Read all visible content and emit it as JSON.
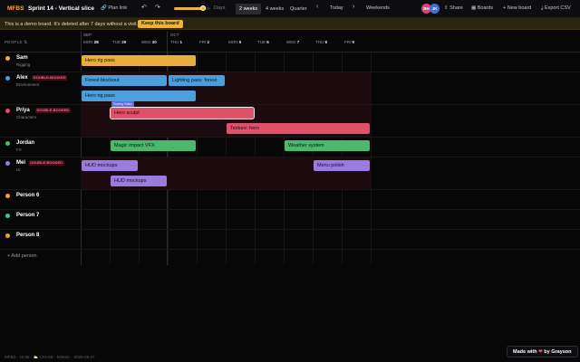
{
  "app": {
    "logo": "MFBS",
    "title": "Sprint 14 - Vertical slice"
  },
  "toolbar": {
    "plan_link": "Plan link",
    "undo_icon": "↶",
    "redo_icon": "↷",
    "zoom_label": "Days",
    "zoom_fraction": 0.8,
    "views": [
      "2 weeks",
      "4 weeks",
      "Quarter"
    ],
    "active_view": "2 weeks",
    "prev_icon": "‹",
    "today": "Today",
    "next_icon": "›",
    "weekends": "Weekends",
    "share": "Share",
    "boards": "Boards",
    "new_board": "+ New board",
    "export": "Export CSV",
    "avatars": [
      {
        "initials": "BH",
        "color": "#d0467a"
      },
      {
        "initials": "JK",
        "color": "#3d6fd6"
      }
    ]
  },
  "banner": {
    "message": "This is a demo board. It's deleted after 7 days without a visit.",
    "keep": "Keep this board"
  },
  "timeline": {
    "people_header": "PEOPLE ⇅",
    "months": [
      {
        "label": "SEP",
        "col": 0
      },
      {
        "label": "OCT",
        "col": 3
      }
    ],
    "days": [
      {
        "dow": "MON",
        "num": "28"
      },
      {
        "dow": "TUE",
        "num": "29"
      },
      {
        "dow": "WED",
        "num": "30"
      },
      {
        "dow": "THU",
        "num": "1"
      },
      {
        "dow": "FRI",
        "num": "2"
      },
      {
        "dow": "MON",
        "num": "5"
      },
      {
        "dow": "TUE",
        "num": "6"
      },
      {
        "dow": "WED",
        "num": "7"
      },
      {
        "dow": "THU",
        "num": "8"
      },
      {
        "dow": "FRI",
        "num": "9"
      }
    ],
    "today_col": 0
  },
  "people": [
    {
      "name": "Sam",
      "role": "Rigging",
      "color": "#f2b233",
      "double_booked": false
    },
    {
      "name": "Alex",
      "role": "Environment",
      "color": "#4b9fdc",
      "double_booked": true
    },
    {
      "name": "Priya",
      "role": "Characters",
      "color": "#e0506a",
      "double_booked": true
    },
    {
      "name": "Jordan",
      "role": "FX",
      "color": "#4bb86f",
      "double_booked": false
    },
    {
      "name": "Mei",
      "role": "UI",
      "color": "#9a7be0",
      "double_booked": true
    },
    {
      "name": "Person 6",
      "role": "",
      "color": "#f2a03a",
      "double_booked": false
    },
    {
      "name": "Person 7",
      "role": "",
      "color": "#3fc2a8",
      "double_booked": false
    },
    {
      "name": "Person 8",
      "role": "",
      "color": "#e0a63a",
      "double_booked": false
    }
  ],
  "double_booked_label": "DOUBLE-BOOKED",
  "tasks": [
    {
      "label": "Hero rig pass",
      "person": 0,
      "lane": 0,
      "start": 0,
      "span": 4,
      "color": "#e7ad3f"
    },
    {
      "label": "Forest blockout",
      "person": 1,
      "lane": 0,
      "start": 0,
      "span": 3,
      "color": "#4b9fdc"
    },
    {
      "label": "Lighting pass: forest",
      "person": 1,
      "lane": 0,
      "start": 3,
      "span": 2,
      "color": "#4b9fdc"
    },
    {
      "label": "Hero rig pass",
      "person": 1,
      "lane": 1,
      "start": 0,
      "span": 4,
      "color": "#4b9fdc"
    },
    {
      "label": "Hero sculpt",
      "person": 2,
      "lane": 0,
      "start": 1,
      "span": 5,
      "color": "#e0506a",
      "selected": true,
      "tag": "Sunny Kato"
    },
    {
      "label": "Texture: hero",
      "person": 2,
      "lane": 1,
      "start": 5,
      "span": 5,
      "color": "#e0506a"
    },
    {
      "label": "Magic impact VFX",
      "person": 3,
      "lane": 0,
      "start": 1,
      "span": 3,
      "color": "#4bb86f"
    },
    {
      "label": "Weather system",
      "person": 3,
      "lane": 0,
      "start": 7,
      "span": 3,
      "color": "#4bb86f"
    },
    {
      "label": "HUD mockups",
      "person": 4,
      "lane": 0,
      "start": 0,
      "span": 2,
      "color": "#9a7be0"
    },
    {
      "label": "Menu polish",
      "person": 4,
      "lane": 0,
      "start": 8,
      "span": 2,
      "color": "#9a7be0"
    },
    {
      "label": "HUD mockups",
      "person": 4,
      "lane": 1,
      "start": 1,
      "span": 2,
      "color": "#9a7be0"
    }
  ],
  "add_person": "+ Add person",
  "footer": "MFBS · v0.58 · ⛅ CHASE · b0942c · 2026-09-27",
  "made_with": {
    "prefix": "Made with",
    "heart": "❤",
    "suffix": "by Grayson"
  }
}
